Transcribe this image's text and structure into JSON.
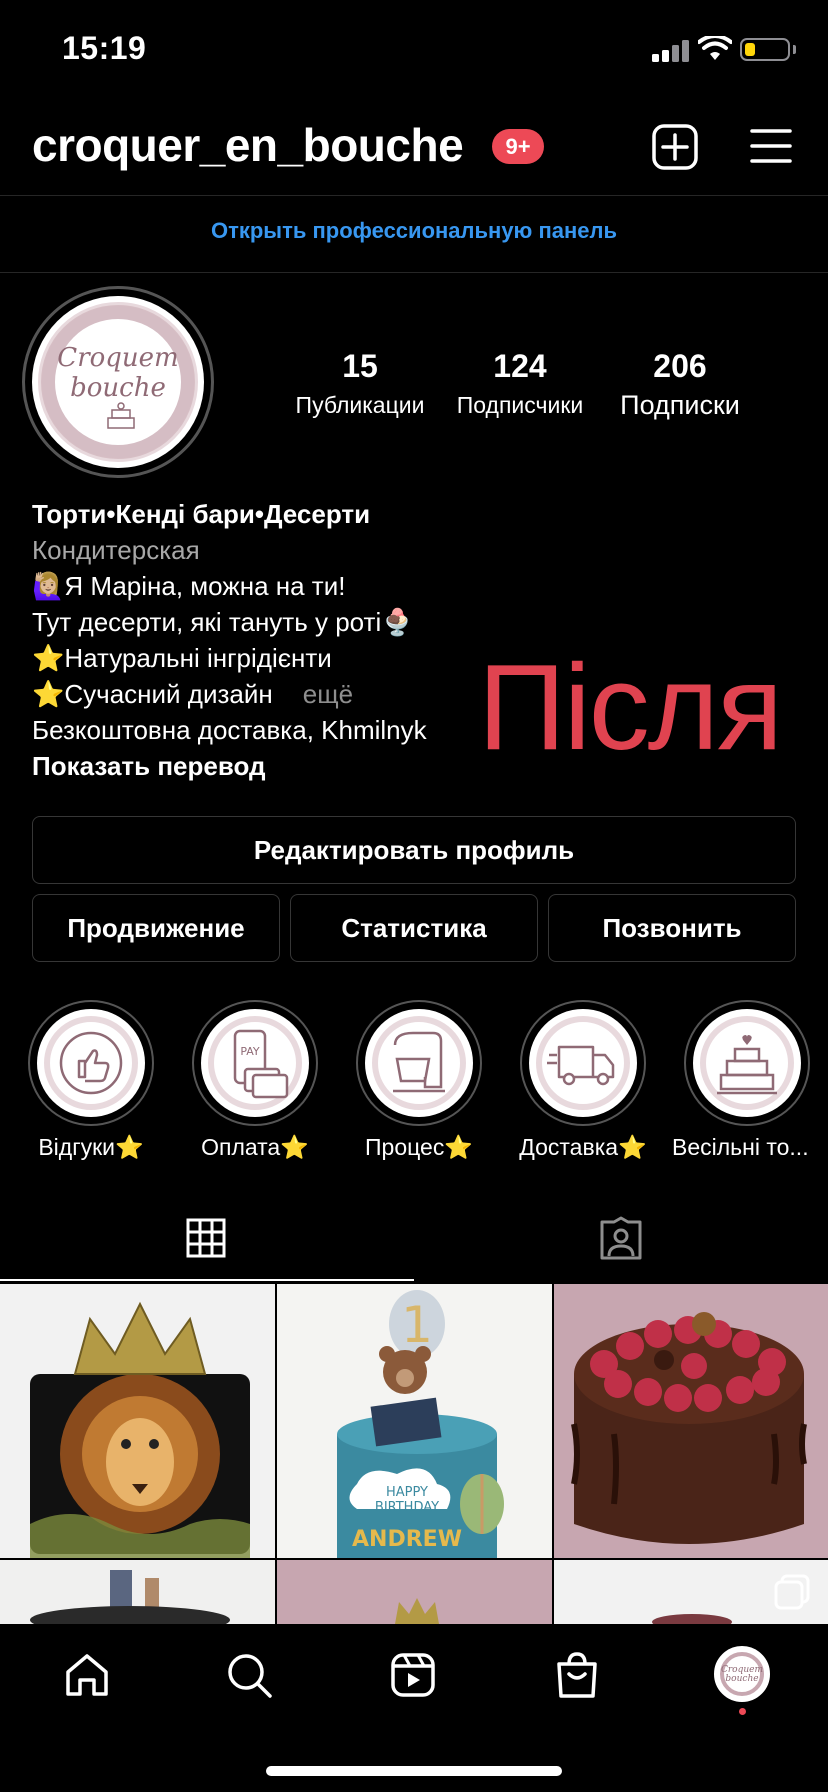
{
  "status_bar": {
    "time": "15:19"
  },
  "header": {
    "username": "croquer_en_bouche",
    "notification_badge": "9+",
    "icons": [
      "new-post-icon",
      "menu-icon"
    ]
  },
  "pro_dashboard_link": "Открыть профессиональную панель",
  "profile": {
    "avatar_text_line1": "Croquem",
    "avatar_text_line2": "bouche",
    "stats": [
      {
        "value": "15",
        "label": "Публикации"
      },
      {
        "value": "124",
        "label": "Подписчики"
      },
      {
        "value": "206",
        "label": "Подписки"
      }
    ],
    "bio": {
      "name": "Торти•Кенді бари•Десерти",
      "category": "Кондитерская",
      "line1": "Я Маріна, можна на ти!",
      "line2": "Тут десерти, які тануть у роті",
      "line3": "Натуральні інгрідієнти",
      "line4": "Сучасний дизайн",
      "more": "ещё",
      "line5": "Безкоштовна доставка, Khmilnyk",
      "translate": "Показать перевод"
    },
    "overlay_caption": "Після"
  },
  "buttons": {
    "edit_profile": "Редактировать профиль",
    "promote": "Продвижение",
    "insights": "Статистика",
    "call": "Позвонить"
  },
  "highlights": [
    {
      "label": "Відгуки⭐️",
      "icon": "thumbs-up-icon"
    },
    {
      "label": "Оплата⭐️",
      "icon": "pay-phone-icon"
    },
    {
      "label": "Процес⭐️",
      "icon": "stand-mixer-icon"
    },
    {
      "label": "Доставка⭐️",
      "icon": "delivery-truck-icon"
    },
    {
      "label": "Весільні то...",
      "icon": "wedding-cake-icon"
    }
  ],
  "tabs": [
    {
      "name": "posts-grid",
      "icon": "grid-icon",
      "active": true
    },
    {
      "name": "tagged",
      "icon": "tagged-person-icon",
      "active": false
    }
  ],
  "grid_posts": [
    {
      "description": "lion cake with gold crown"
    },
    {
      "description": "blue birthday cake with bear and balloon",
      "cake_text1": "HAPPY",
      "cake_text2": "BIRTHDAY",
      "cake_text3": "ANDREW"
    },
    {
      "description": "chocolate drip cake with raspberries"
    }
  ],
  "bottom_nav": [
    "home-icon",
    "search-icon",
    "reels-icon",
    "shop-icon",
    "profile-avatar"
  ],
  "colors": {
    "accent_blue": "#3897f0",
    "badge_red": "#ed4956",
    "overlay_red": "#e04350",
    "logo_mauve": "#8f6a75"
  }
}
